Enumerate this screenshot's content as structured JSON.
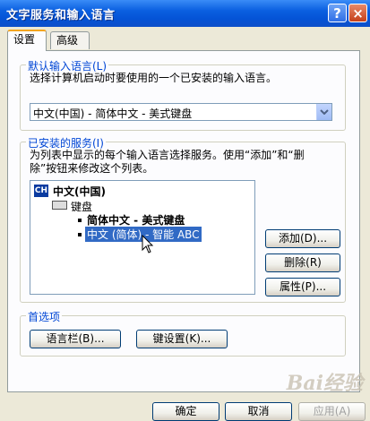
{
  "window": {
    "title": "文字服务和输入语言"
  },
  "title_buttons": {
    "help": "?",
    "close": "×"
  },
  "tabs": [
    {
      "label": "设置",
      "active": true
    },
    {
      "label": "高级",
      "active": false
    }
  ],
  "default_lang": {
    "group_label": "默认输入语言(L)",
    "description": "选择计算机启动时要使用的一个已安装的输入语言。",
    "selected": "中文(中国) - 简体中文 - 美式键盘"
  },
  "installed": {
    "group_label": "已安装的服务(I)",
    "description_line1": "为列表中显示的每个输入语言选择服务。使用“添加”和“删",
    "description_line2": "除”按钮来修改这个列表。",
    "lang_code": "CH",
    "language": "中文(中国)",
    "keyboard": "键盘",
    "services": [
      {
        "label": "简体中文 - 美式键盘",
        "selected": false
      },
      {
        "label": "中文 (简体) - 智能 ABC",
        "selected": true
      }
    ],
    "add_button": "添加(D)...",
    "remove_button": "删除(R)",
    "properties_button": "属性(P)..."
  },
  "preferences": {
    "group_label": "首选项",
    "language_bar_button": "语言栏(B)...",
    "key_settings_button": "键设置(K)..."
  },
  "footer": {
    "ok": "确定",
    "cancel": "取消",
    "apply": "应用(A)"
  },
  "watermark": "Bai经验"
}
